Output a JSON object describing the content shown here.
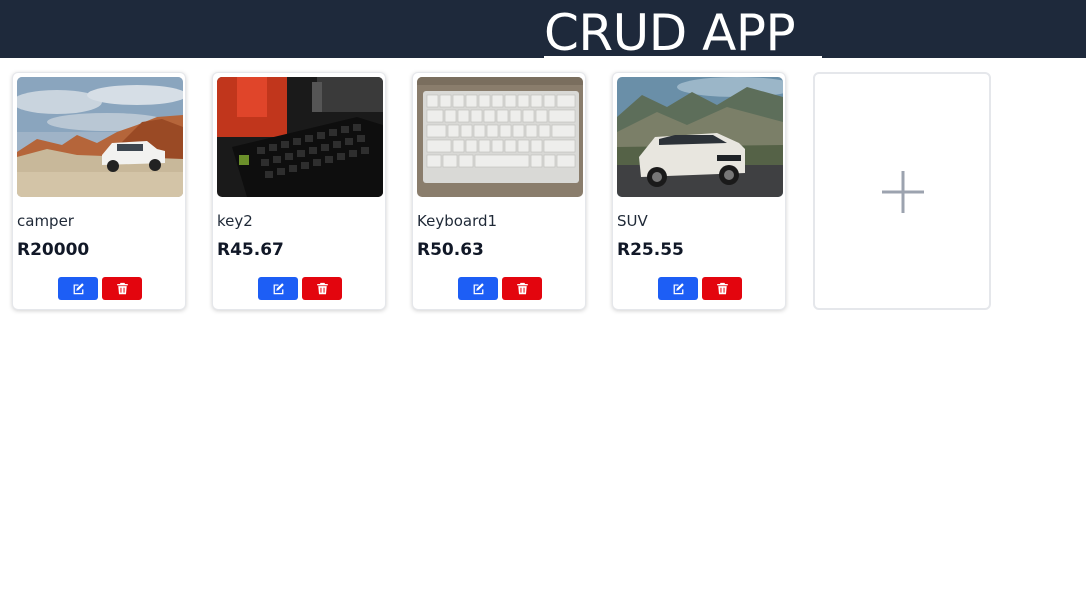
{
  "header": {
    "title": "CRUD APP"
  },
  "products": [
    {
      "name": "camper",
      "price": "R20000",
      "image": "white SUV in desert canyon"
    },
    {
      "name": "key2",
      "price": "R45.67",
      "image": "dark mechanical keyboard with red backlight"
    },
    {
      "name": "Keyboard1",
      "price": "R50.63",
      "image": "white keyboard on wooden surface"
    },
    {
      "name": "SUV",
      "price": "R25.55",
      "image": "white SUV in front of mountains"
    }
  ],
  "icons": {
    "edit": "edit-icon",
    "delete": "trash-icon",
    "add": "plus-icon"
  },
  "colors": {
    "header_bg": "#1e293b",
    "edit_button": "#1d5ef5",
    "delete_button": "#e3050e"
  }
}
